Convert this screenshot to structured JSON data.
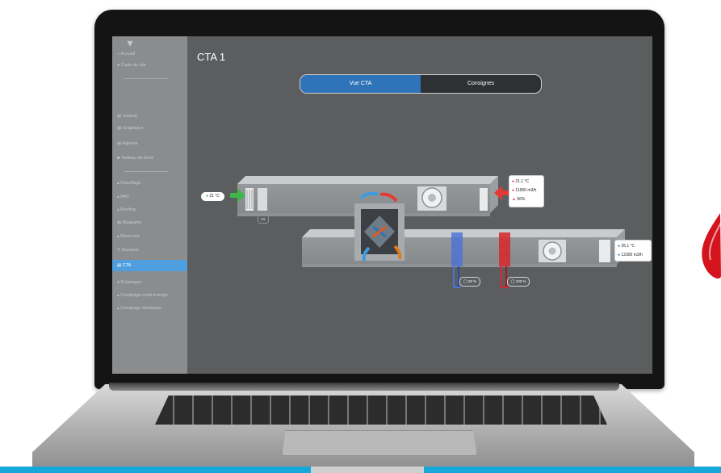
{
  "page": {
    "title": "CTA 1"
  },
  "tabs": [
    {
      "label": "Vue CTA",
      "active": true
    },
    {
      "label": "Consignes",
      "active": false
    }
  ],
  "sidebar": {
    "items": [
      {
        "label": "Accueil",
        "icon": "home-icon"
      },
      {
        "label": "Carte du site",
        "icon": "map-pin-icon"
      },
      {
        "label": "Journal",
        "icon": "journal-icon"
      },
      {
        "label": "Graphique",
        "icon": "chart-icon"
      },
      {
        "label": "Agenda",
        "icon": "calendar-icon"
      },
      {
        "label": "Tableau de bord",
        "icon": "dashboard-icon"
      },
      {
        "label": "Chauffage",
        "icon": "heating-icon"
      },
      {
        "label": "PAC",
        "icon": "heat-pump-icon"
      },
      {
        "label": "Rooftop",
        "icon": "rooftop-icon"
      },
      {
        "label": "Magasins",
        "icon": "store-icon"
      },
      {
        "label": "Réserves",
        "icon": "storage-icon"
      },
      {
        "label": "Bureaux",
        "icon": "office-icon"
      },
      {
        "label": "CTA",
        "icon": "air-handler-icon",
        "active": true
      },
      {
        "label": "Eclairages",
        "icon": "light-icon"
      },
      {
        "label": "Comptage multi-énergie",
        "icon": "meter-icon"
      },
      {
        "label": "Comptage électrique",
        "icon": "electric-meter-icon"
      }
    ]
  },
  "diagram": {
    "fresh_air_temp": "21 °C",
    "filter_label": "F8",
    "return_air": {
      "temp": "21.1 °C",
      "flow": "11900 m3/h",
      "humidity": "56%"
    },
    "supply_air": {
      "temp": "26.1 °C",
      "flow": "12300 m3/h"
    },
    "cold_valve": "50 %",
    "hot_valve": "100 %"
  },
  "colors": {
    "accent": "#2f73b8",
    "sidebar_active": "#4f9fe0",
    "fresh_air_arrow": "#3fb54a",
    "return_air_arrow": "#e53935",
    "cold_coil": "#3a66d6",
    "hot_coil": "#d8262a"
  }
}
